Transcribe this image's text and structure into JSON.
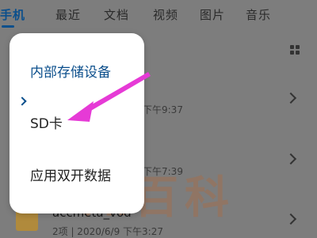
{
  "tabs": [
    {
      "label": "手机",
      "active": true
    },
    {
      "label": "最近",
      "active": false
    },
    {
      "label": "文档",
      "active": false
    },
    {
      "label": "视频",
      "active": false
    },
    {
      "label": "图片",
      "active": false
    },
    {
      "label": "音乐",
      "active": false
    }
  ],
  "background_rows": [
    {
      "time": "下午9:37"
    },
    {
      "time": "下午7:39"
    }
  ],
  "last_row": {
    "name": "accmeta_vod",
    "meta": "2项 | 2020/6/9 下午3:27"
  },
  "menu": {
    "items": [
      {
        "label": "内部存储设备",
        "current": true
      },
      {
        "label": "SD卡",
        "current": false
      },
      {
        "label": "应用双开数据",
        "current": false
      }
    ]
  },
  "watermark": {
    "symbol": "?",
    "text": "知百科"
  },
  "colors": {
    "accent": "#0b4f8c",
    "annotation_arrow": "#e63ad6",
    "overlay": "#7d7d7d"
  }
}
